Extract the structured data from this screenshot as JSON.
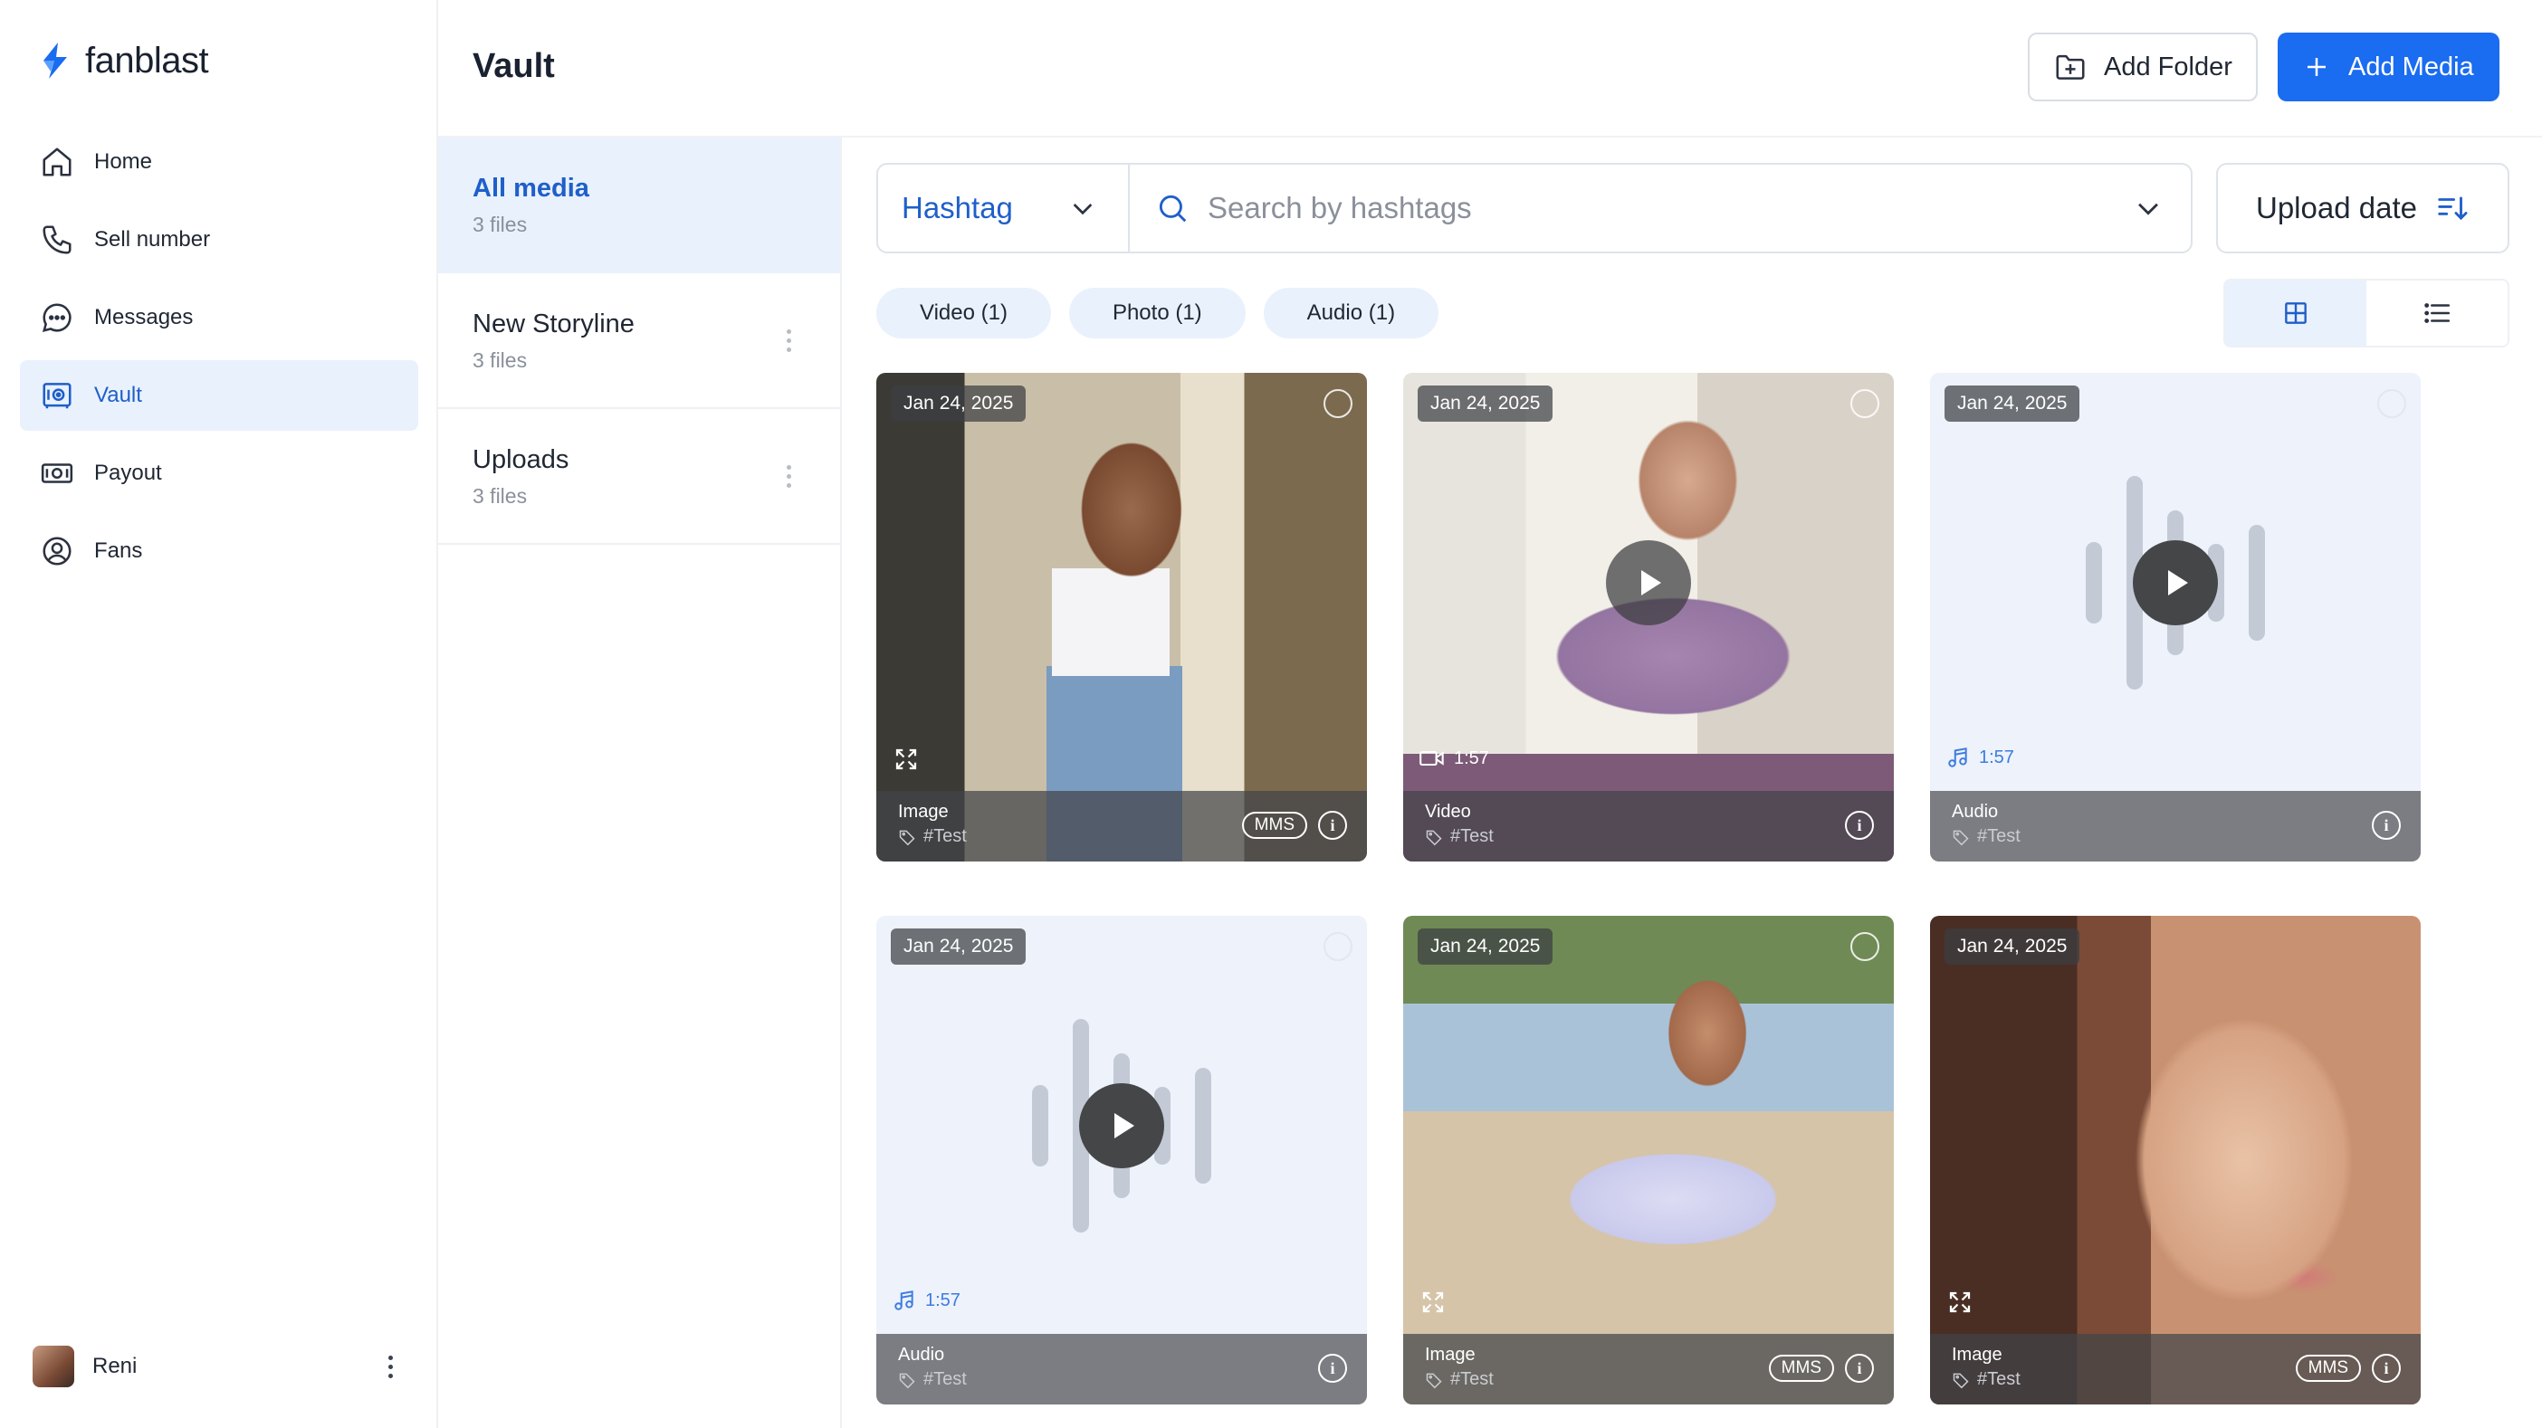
{
  "app": {
    "name": "fanblast"
  },
  "sidebar": {
    "items": [
      {
        "label": "Home",
        "icon": "home-icon"
      },
      {
        "label": "Sell number",
        "icon": "phone-icon"
      },
      {
        "label": "Messages",
        "icon": "chat-icon"
      },
      {
        "label": "Vault",
        "icon": "vault-icon",
        "active": true
      },
      {
        "label": "Payout",
        "icon": "money-icon"
      },
      {
        "label": "Fans",
        "icon": "user-circle-icon"
      }
    ],
    "user": {
      "name": "Reni"
    }
  },
  "header": {
    "title": "Vault",
    "add_folder_label": "Add Folder",
    "add_media_label": "Add Media"
  },
  "folders": [
    {
      "name": "All media",
      "count": "3 files",
      "active": true
    },
    {
      "name": "New Storyline",
      "count": "3 files"
    },
    {
      "name": "Uploads",
      "count": "3 files"
    }
  ],
  "filters": {
    "hashtag_select": "Hashtag",
    "search_placeholder": "Search by hashtags",
    "sort_label": "Upload date",
    "chips": [
      "Video (1)",
      "Photo (1)",
      "Audio (1)"
    ]
  },
  "media": [
    {
      "date": "Jan 24, 2025",
      "type": "Image",
      "tag": "#Test",
      "mms": "MMS"
    },
    {
      "date": "Jan 24, 2025",
      "type": "Video",
      "tag": "#Test",
      "duration": "1:57"
    },
    {
      "date": "Jan 24, 2025",
      "type": "Audio",
      "tag": "#Test",
      "duration": "1:57"
    },
    {
      "date": "Jan 24, 2025",
      "type": "Audio",
      "tag": "#Test",
      "duration": "1:57"
    },
    {
      "date": "Jan 24, 2025",
      "type": "Image",
      "tag": "#Test",
      "mms": "MMS"
    },
    {
      "date": "Jan 24, 2025",
      "type": "Image",
      "tag": "#Test",
      "mms": "MMS"
    }
  ],
  "colors": {
    "accent": "#1a6cf0",
    "active_bg": "#e9f1fd",
    "active_text": "#1f5fc9"
  }
}
